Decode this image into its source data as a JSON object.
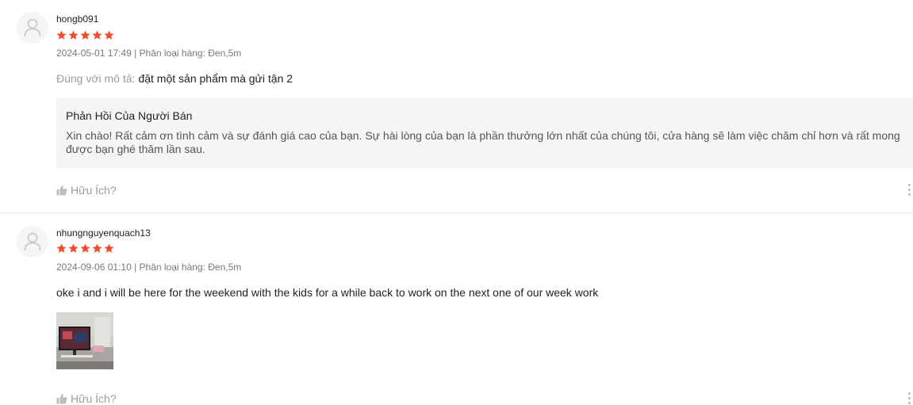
{
  "reviews": [
    {
      "username": "hongb091",
      "rating": 5,
      "meta": "2024-05-01 17:49 | Phân loại hàng: Đen,5m",
      "content_label": "Đúng với mô tả:",
      "content": "đặt một sản phẩm mà gửi tận 2",
      "seller_reply": {
        "title": "Phản Hồi Của Người Bán",
        "body": "Xin chào! Rất cảm ơn tình cảm và sự đánh giá cao của bạn. Sự hài lòng của bạn là phần thưởng lớn nhất của chúng tôi, cửa hàng sẽ làm việc chăm chỉ hơn và rất mong được bạn ghé thăm lần sau."
      },
      "helpful_label": "Hữu Ích?"
    },
    {
      "username": "nhungnguyenquach13",
      "rating": 5,
      "meta": "2024-09-06 01:10 | Phân loại hàng: Đen,5m",
      "content": "oke i and i will be here for the weekend with the kids for a while back to work on the next one of our week work",
      "helpful_label": "Hữu Ích?"
    }
  ],
  "colors": {
    "star": "#ee4d2d",
    "muted_text": "#8a8a8a",
    "reply_bg": "#f5f5f5",
    "divider": "#e5e5e5"
  },
  "icons": [
    "avatar-placeholder-icon",
    "star-icon",
    "thumbs-up-icon",
    "more-options-icon"
  ]
}
